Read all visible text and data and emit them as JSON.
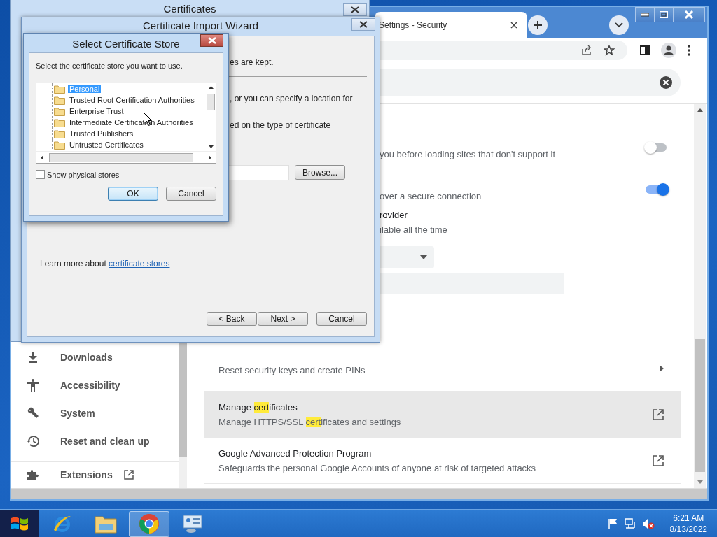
{
  "certificates_window": {
    "title": "Certificates"
  },
  "browser": {
    "tab": {
      "title": "Settings - Security"
    },
    "sidebar": {
      "items": [
        {
          "label": "Downloads",
          "external": false
        },
        {
          "label": "Accessibility",
          "external": false
        },
        {
          "label": "System",
          "external": false
        },
        {
          "label": "Reset and clean up",
          "external": false
        },
        {
          "label": "Extensions",
          "external": true
        }
      ]
    },
    "settings": {
      "upper": [
        {
          "kind": "toggle",
          "description": "you before loading sites that don't support it",
          "on": false
        },
        {
          "kind": "toggle",
          "description": "over a secure connection",
          "on": true
        },
        {
          "kind": "option",
          "title": "rovider",
          "description": "ilable all the time"
        },
        {
          "kind": "select"
        },
        {
          "kind": "field"
        }
      ],
      "rows": [
        {
          "kind": "arrow",
          "highlighted": false,
          "title": [],
          "description": [
            {
              "text": "Reset security keys and create PINs",
              "match": false
            }
          ]
        },
        {
          "kind": "external",
          "highlighted": true,
          "title": [
            {
              "text": "Manage ",
              "match": false
            },
            {
              "text": "cert",
              "match": true
            },
            {
              "text": "ificates",
              "match": false
            }
          ],
          "description": [
            {
              "text": "Manage HTTPS/SSL ",
              "match": false
            },
            {
              "text": "cert",
              "match": true
            },
            {
              "text": "ificates and settings",
              "match": false
            }
          ]
        },
        {
          "kind": "external",
          "highlighted": false,
          "title": [
            {
              "text": "Google Advanced Protection Program",
              "match": false
            }
          ],
          "description": [
            {
              "text": "Safeguards the personal Google Accounts of anyone at risk of targeted attacks",
              "match": false
            }
          ]
        }
      ]
    }
  },
  "wizard": {
    "title": "Certificate Import Wizard",
    "lines": [
      "es are kept.",
      ", or you can specify a location for",
      "ed on the type of certificate"
    ],
    "browse_button": "Browse...",
    "learn_more": {
      "text": "Learn more about ",
      "link": "certificate stores"
    },
    "buttons": [
      "< Back",
      "Next >",
      "Cancel"
    ]
  },
  "store_dialog": {
    "title": "Select Certificate Store",
    "prompt": "Select the certificate store you want to use.",
    "stores": [
      {
        "label": "Personal",
        "selected": true
      },
      {
        "label": "Trusted Root Certification Authorities",
        "selected": false
      },
      {
        "label": "Enterprise Trust",
        "selected": false
      },
      {
        "label": "Intermediate Certification Authorities",
        "selected": false
      },
      {
        "label": "Trusted Publishers",
        "selected": false
      },
      {
        "label": "Untrusted Certificates",
        "selected": false
      }
    ],
    "show_physical_stores": {
      "label": "Show physical stores",
      "checked": false
    },
    "buttons": [
      {
        "label": "OK",
        "default": true
      },
      {
        "label": "Cancel",
        "default": false
      }
    ]
  },
  "taskbar": {
    "apps": [
      {
        "active": false
      },
      {
        "active": false
      },
      {
        "active": true
      },
      {
        "active": false
      }
    ],
    "clock": {
      "time": "6:21 AM",
      "date": "8/13/2022"
    }
  }
}
